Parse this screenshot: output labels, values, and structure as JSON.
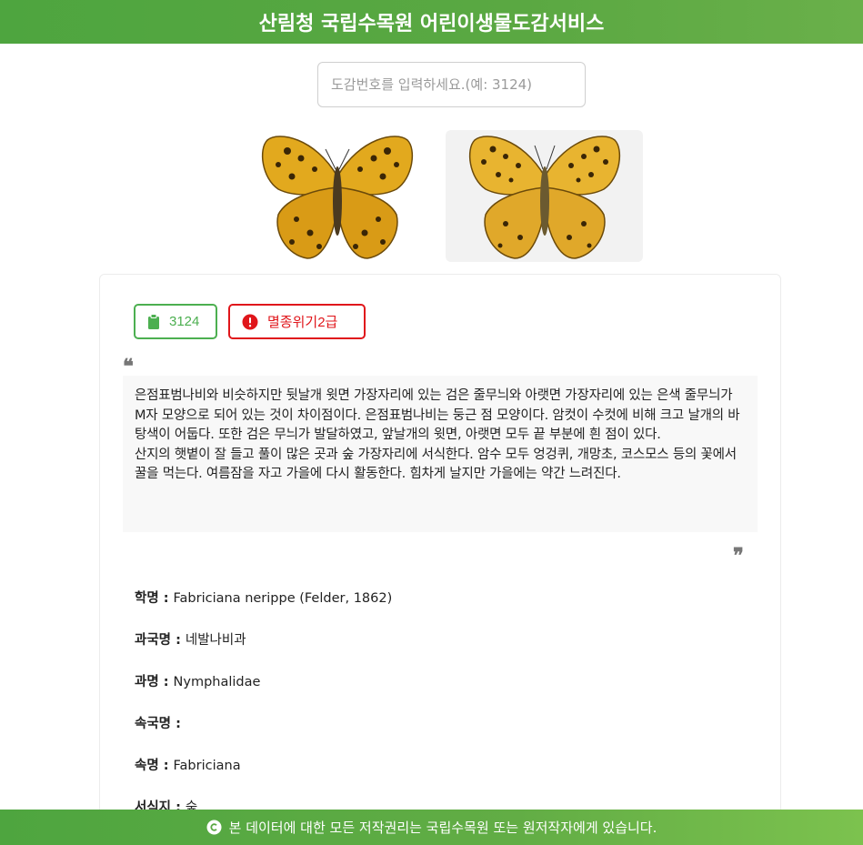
{
  "header": {
    "title": "산림청 국립수목원 어린이생물도감서비스"
  },
  "search": {
    "placeholder": "도감번호를 입력하세요.(예: 3124)",
    "value": ""
  },
  "photos": [
    {
      "icon": "butterfly-dorsal-photo"
    },
    {
      "icon": "butterfly-ventral-photo"
    }
  ],
  "badges": {
    "id": "3124",
    "status": "멸종위기2급",
    "id_color": "#4caf50",
    "status_color": "#e0161b"
  },
  "description": "은점표범나비와 비슷하지만 뒷날개 윗면 가장자리에 있는 검은 줄무늬와 아랫면 가장자리에 있는 은색 줄무늬가 M자 모양으로 되어 있는 것이 차이점이다. 은점표범나비는 둥근 점 모양이다. 암컷이 수컷에 비해 크고 날개의 바탕색이 어둡다. 또한 검은 무늬가 발달하였고, 앞날개의 윗면, 아랫면 모두 끝 부분에 흰 점이 있다.\n산지의 햇볕이 잘 들고 풀이 많은 곳과 숲 가장자리에 서식한다. 암수 모두 엉겅퀴, 개망초, 코스모스 등의 꽃에서 꿀을 먹는다. 여름잠을 자고 가을에 다시 활동한다. 힘차게 날지만 가을에는 약간 느려진다.",
  "fields": [
    {
      "label": "학명 :",
      "value": "Fabriciana nerippe (Felder, 1862)"
    },
    {
      "label": "과국명 :",
      "value": "네발나비과"
    },
    {
      "label": "과명 :",
      "value": "Nymphalidae"
    },
    {
      "label": "속국명 :",
      "value": ""
    },
    {
      "label": "속명 :",
      "value": "Fabriciana"
    },
    {
      "label": "서식지 :",
      "value": "숲"
    }
  ],
  "footer": {
    "text": "본 데이터에 대한 모든 저작권리는 국립수목원 또는 원저작자에게 있습니다."
  },
  "colors": {
    "brand_green": "#5aa842",
    "danger_red": "#e0161b"
  }
}
